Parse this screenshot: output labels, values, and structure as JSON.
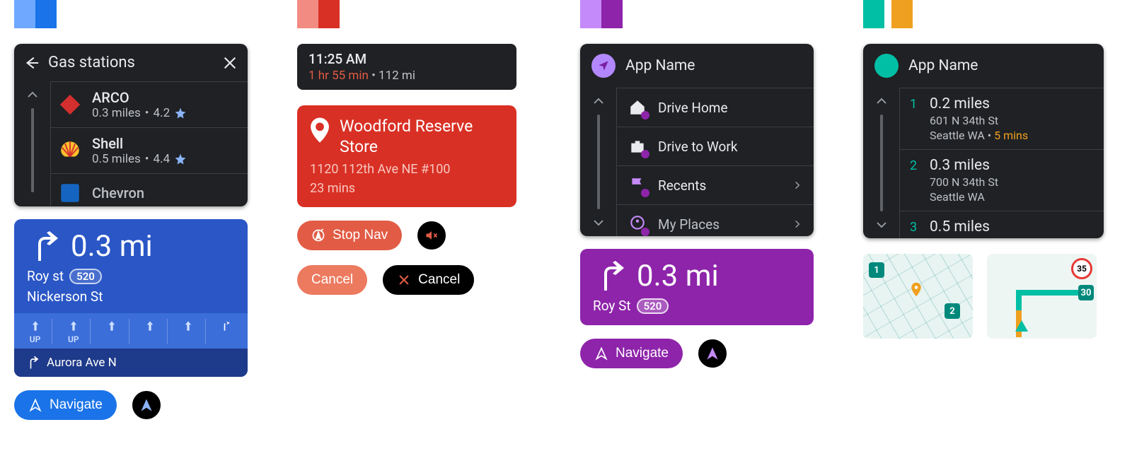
{
  "col1": {
    "title": "Gas stations",
    "items": [
      {
        "name": "ARCO",
        "dist": "0.3 miles",
        "rating": "4.2"
      },
      {
        "name": "Shell",
        "dist": "0.5 miles",
        "rating": "4.4"
      },
      {
        "name": "Chevron",
        "dist": "",
        "rating": ""
      }
    ],
    "turn": {
      "dist": "0.3 mi",
      "street": "Roy st",
      "route": "520",
      "cross": "Nickerson St",
      "lanes": [
        "UP",
        "UP",
        "",
        "",
        "",
        ""
      ],
      "next_street": "Aurora Ave N"
    },
    "navigate_label": "Navigate"
  },
  "col2": {
    "time": "11:25 AM",
    "eta": "1 hr 55 min",
    "dist": "112 mi",
    "dest_name": "Woodford Reserve Store",
    "dest_addr": "1120 112th Ave NE #100",
    "dest_eta": "23 mins",
    "stop_label": "Stop Nav",
    "cancel_label": "Cancel",
    "cancel2_label": "Cancel"
  },
  "col3": {
    "app_name": "App Name",
    "menu": [
      {
        "label": "Drive Home"
      },
      {
        "label": "Drive to Work"
      },
      {
        "label": "Recents"
      },
      {
        "label": "My Places"
      }
    ],
    "turn": {
      "dist": "0.3 mi",
      "street": "Roy St",
      "route": "520"
    },
    "navigate_label": "Navigate"
  },
  "col4": {
    "app_name": "App Name",
    "results": [
      {
        "num": "1",
        "dist": "0.2 miles",
        "addr": "601 N 34th St",
        "city": "Seattle WA",
        "eta": "5 mins"
      },
      {
        "num": "2",
        "dist": "0.3 miles",
        "addr": "700 N 34th St",
        "city": "Seattle WA",
        "eta": ""
      },
      {
        "num": "3",
        "dist": "0.5 miles",
        "addr": "",
        "city": "",
        "eta": ""
      }
    ],
    "map2": {
      "speed": "35",
      "pin": "30"
    }
  }
}
